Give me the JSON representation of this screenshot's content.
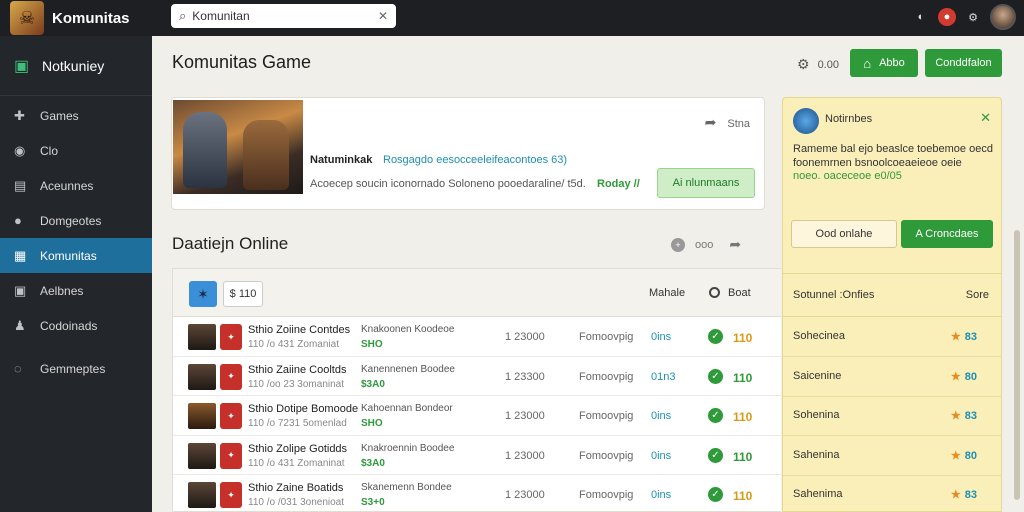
{
  "app": {
    "name": "Komunitas",
    "logo_icon": "warrior-logo-icon"
  },
  "search": {
    "value": "Komunitan",
    "placeholder": "Komunitan"
  },
  "sidebar": {
    "header": "Notkuniey",
    "items": [
      {
        "label": "Games",
        "icon": "gamepad-icon"
      },
      {
        "label": "Clo",
        "icon": "cloud-icon"
      },
      {
        "label": "Aceunnes",
        "icon": "list-icon"
      },
      {
        "label": "Domgeotes",
        "icon": "chat-icon"
      },
      {
        "label": "Komunitas",
        "icon": "community-icon",
        "active": true
      },
      {
        "label": "Aelbnes",
        "icon": "image-icon"
      },
      {
        "label": "Codoinads",
        "icon": "user-icon"
      },
      {
        "label": "Gemmeptes",
        "icon": "settings-icon"
      }
    ]
  },
  "header": {
    "title": "Komunitas Game",
    "tool_label": "0.00",
    "btn_primary": "Abbo",
    "btn_secondary": "Conddfalon"
  },
  "hero": {
    "title": "Natuminkak",
    "tag": "Rosgagdo eesocceeleifeacontoes 63)",
    "subtitle": "Acoecep soucin iconornado Soloneno pooedaraline/ t5d.",
    "subtitle_highlight": "Roday //",
    "action": "Ai nlunmaans",
    "share": "Stna"
  },
  "section": {
    "title": "Daatiejn Online",
    "count_label": "ooo"
  },
  "table": {
    "filter_count": "$ 110",
    "col_rank": "Mahale",
    "col_status": "Boat",
    "rows": [
      {
        "name": "Sthio Zoiine Contdes",
        "meta": "110 /o 431 Zomaniat",
        "desc": "Knakoonen Koodeoe",
        "price": "SHO",
        "score": "1 23000",
        "genre": "Fomoovpig",
        "rank": "0ins",
        "val": "110"
      },
      {
        "name": "Sthio Zaiine Cooltds",
        "meta": "110 /oo 23 3omaninat",
        "desc": "Kanennenen Boodee",
        "price": "$3A0",
        "score": "1 23300",
        "genre": "Fomoovpig",
        "rank": "01n3",
        "val": "110"
      },
      {
        "name": "Sthio Dotipe Bomoode",
        "meta": "110 /o 7231 5omenlad",
        "desc": "Kahoennan Bondeor",
        "price": "SHO",
        "score": "1 23000",
        "genre": "Fomoovpig",
        "rank": "0ins",
        "val": "110"
      },
      {
        "name": "Sthio Zolipe Gotidds",
        "meta": "110 /o 431 Zomaninat",
        "desc": "Knakroennin Boodee",
        "price": "$3A0",
        "score": "1 23000",
        "genre": "Fomoovpig",
        "rank": "0ins",
        "val": "110"
      },
      {
        "name": "Sthio Zaine Boatids",
        "meta": "110 /o /031 3onenioat",
        "desc": "Skanemenn Bondee",
        "price": "S3+0",
        "score": "1 23000",
        "genre": "Fomoovpig",
        "rank": "0ins",
        "val": "110"
      }
    ]
  },
  "panel": {
    "title": "Notirnbes",
    "text": "Rameme bal ejo beaslce toebemoe oecd foonemrnen bsnoolcoeaeieoe oeie",
    "text_green": "noeo. oaceceoe e0/05",
    "btn_outline": "Ood onlahe",
    "btn_green": "A Croncdaes",
    "col_name": "Sotunnel :Onfies",
    "col_score": "Sore",
    "rows": [
      {
        "name": "Sohecinea",
        "score": "83"
      },
      {
        "name": "Saicenine",
        "score": "80"
      },
      {
        "name": "Sohenina",
        "score": "83"
      },
      {
        "name": "Sahenina",
        "score": "80"
      },
      {
        "name": "Sahenima",
        "score": "83"
      }
    ]
  },
  "colors": {
    "accent": "#2f9a3a",
    "active_nav": "#1f6f9c",
    "panel_bg": "#fbefb9",
    "topbar": "#1d1f22"
  }
}
